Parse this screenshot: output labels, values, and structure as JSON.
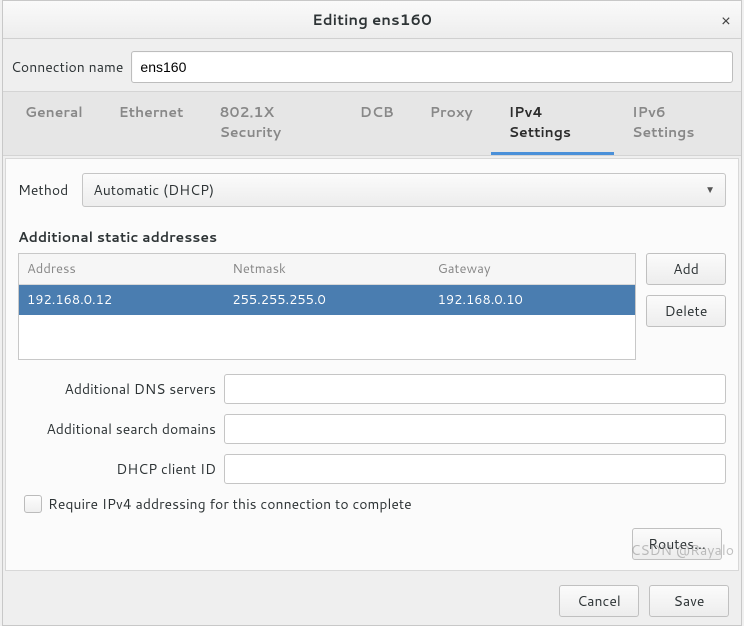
{
  "title": "Editing ens160",
  "connection_name_label": "Connection name",
  "connection_name_value": "ens160",
  "tabs": [
    {
      "label": "General"
    },
    {
      "label": "Ethernet"
    },
    {
      "label": "802.1X Security"
    },
    {
      "label": "DCB"
    },
    {
      "label": "Proxy"
    },
    {
      "label": "IPv4 Settings"
    },
    {
      "label": "IPv6 Settings"
    }
  ],
  "active_tab_index": 5,
  "ipv4": {
    "method_label": "Method",
    "method_value": "Automatic (DHCP)",
    "addresses_title": "Additional static addresses",
    "headers": {
      "address": "Address",
      "netmask": "Netmask",
      "gateway": "Gateway"
    },
    "rows": [
      {
        "address": "192.168.0.12",
        "netmask": "255.255.255.0",
        "gateway": "192.168.0.10"
      }
    ],
    "add_label": "Add",
    "delete_label": "Delete",
    "dns_label": "Additional DNS servers",
    "dns_value": "",
    "search_label": "Additional search domains",
    "search_value": "",
    "client_id_label": "DHCP client ID",
    "client_id_value": "",
    "require_label": "Require IPv4 addressing for this connection to complete",
    "routes_label": "Routes…"
  },
  "footer": {
    "cancel": "Cancel",
    "save": "Save"
  },
  "watermark": "CSDN @Rayalo"
}
